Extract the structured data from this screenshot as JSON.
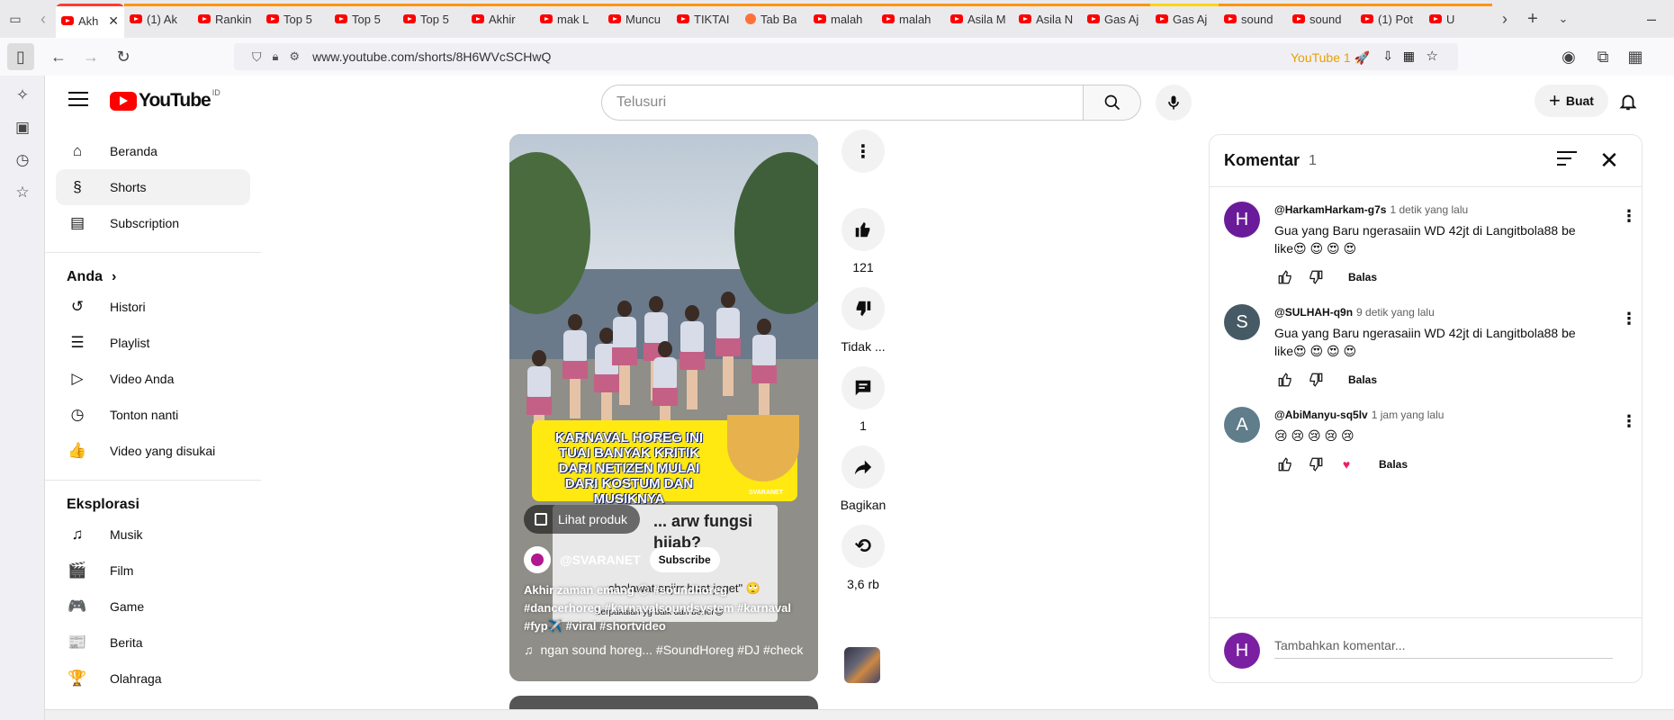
{
  "browser": {
    "tabs": [
      {
        "title": "Akh",
        "active": true,
        "color": "#ff3b30"
      },
      {
        "title": "(1) Ak",
        "color": "#ff9500"
      },
      {
        "title": "Rankin",
        "color": "#ff9500"
      },
      {
        "title": "Top 5",
        "color": "#ff9500"
      },
      {
        "title": "Top 5",
        "color": "#ff9500"
      },
      {
        "title": "Top 5",
        "color": "#ff9500"
      },
      {
        "title": "Akhir",
        "color": "#ff9500"
      },
      {
        "title": "mak L",
        "color": "#ff9500"
      },
      {
        "title": "Muncu",
        "color": "#ff9500"
      },
      {
        "title": "TIKTAI",
        "color": "#ff9500"
      },
      {
        "title": "Tab Ba",
        "color": "#ff9500",
        "firefox": true
      },
      {
        "title": "malah",
        "color": "#ff9500"
      },
      {
        "title": "malah",
        "color": "#ff9500"
      },
      {
        "title": "Asila M",
        "color": "#ff9500"
      },
      {
        "title": "Asila N",
        "color": "#ff9500"
      },
      {
        "title": "Gas Aj",
        "color": "#ff9500"
      },
      {
        "title": "Gas Aj",
        "color": "#ffd60a"
      },
      {
        "title": "sound",
        "color": "#ff9500"
      },
      {
        "title": "sound",
        "color": "#ff9500"
      },
      {
        "title": "(1) Pot",
        "color": "#ff9500"
      },
      {
        "title": "U",
        "color": "#ff9500"
      }
    ],
    "url": "www.youtube.com/shorts/8H6WVcSCHwQ",
    "yt_badge": "YouTube 1 🚀"
  },
  "masthead": {
    "logo_text": "YouTube",
    "country": "ID",
    "search_placeholder": "Telusuri",
    "create_label": "Buat"
  },
  "guide": {
    "main": [
      {
        "label": "Beranda",
        "icon": "home-icon",
        "glyph": "⌂"
      },
      {
        "label": "Shorts",
        "icon": "shorts-icon",
        "glyph": "§",
        "selected": true
      },
      {
        "label": "Subscription",
        "icon": "subscriptions-icon",
        "glyph": "▤"
      }
    ],
    "you_heading": "Anda",
    "you": [
      {
        "label": "Histori",
        "icon": "history-icon",
        "glyph": "↺"
      },
      {
        "label": "Playlist",
        "icon": "playlist-icon",
        "glyph": "☰"
      },
      {
        "label": "Video Anda",
        "icon": "your-videos-icon",
        "glyph": "▷"
      },
      {
        "label": "Tonton nanti",
        "icon": "watch-later-icon",
        "glyph": "◷"
      },
      {
        "label": "Video yang disukai",
        "icon": "liked-videos-icon",
        "glyph": "👍"
      }
    ],
    "explore_heading": "Eksplorasi",
    "explore": [
      {
        "label": "Musik",
        "icon": "music-icon",
        "glyph": "♫"
      },
      {
        "label": "Film",
        "icon": "film-icon",
        "glyph": "🎬"
      },
      {
        "label": "Game",
        "icon": "gaming-icon",
        "glyph": "🎮"
      },
      {
        "label": "Berita",
        "icon": "news-icon",
        "glyph": "📰"
      },
      {
        "label": "Olahraga",
        "icon": "sports-icon",
        "glyph": "🏆"
      }
    ]
  },
  "short": {
    "banner_text": "KARNAVAL HOREG INI TUAI BANYAK KRITIK DARI NETIZEN MULAI DARI KOSTUM DAN MUSIKNYA",
    "banner_watermark": "SVARANET",
    "overlay_question": "... arw fungsi hijab?",
    "overlay_answer": "sholawat anjirr buat joget\" 🙄",
    "overlay_footer": "berpakaian yg baik dan bener😊",
    "product_button": "Lihat produk",
    "channel": "@SVARANET",
    "subscribe": "Subscribe",
    "description": "Akhir zaman emang 😏 #soundhoreg #dancerhoreg #karnavalsoundsystem #karnaval #fyp✈️ #viral #shortvideo",
    "music": "ngan sound horeg... #SoundHoreg #DJ #check"
  },
  "actions": {
    "likes": "121",
    "dislike_label": "Tidak ...",
    "comments": "1",
    "share_label": "Bagikan",
    "remix_count": "3,6 rb"
  },
  "comments_panel": {
    "title": "Komentar",
    "count": "1",
    "add_placeholder": "Tambahkan komentar...",
    "user_initial": "H",
    "reply_label": "Balas",
    "items": [
      {
        "initial": "H",
        "avatar_color": "#6a1b9a",
        "author": "@HarkamHarkam-g7s",
        "time": "1 detik yang lalu",
        "text": "Gua yang Baru ngerasaiin WD 42jt di Langitbola88 be like😍 😍 😍 😍"
      },
      {
        "initial": "S",
        "avatar_color": "#455a64",
        "author": "@SULHAH-q9n",
        "time": "9 detik yang lalu",
        "text": "Gua yang Baru ngerasaiin WD 42jt di Langitbola88 be like😍 😍 😍 😍"
      },
      {
        "initial": "A",
        "avatar_color": "#607d8b",
        "author": "@AbiManyu-sq5lv",
        "time": "1 jam yang lalu",
        "text": "😢 😢 😢 😢 😢",
        "creator_heart": true
      }
    ]
  }
}
